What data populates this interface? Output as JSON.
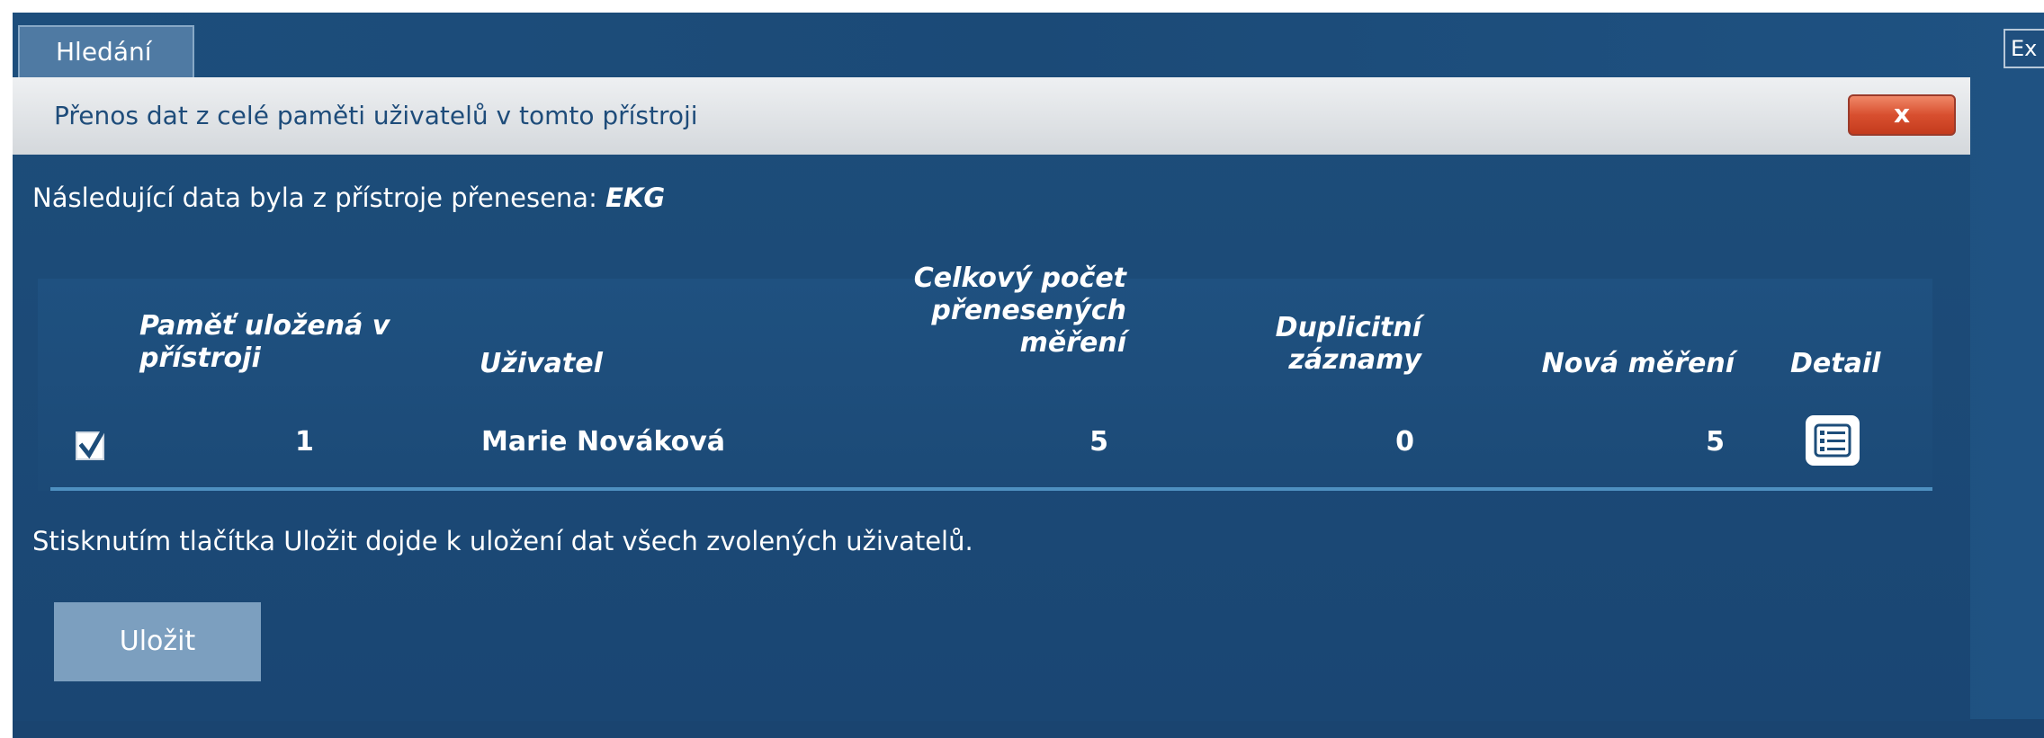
{
  "tab": {
    "label": "Hledání"
  },
  "exit_button": {
    "label": "Ex"
  },
  "dialog": {
    "title": "Přenos dat z celé paměti uživatelů v tomto přístroji",
    "close_label": "x",
    "info_prefix": "Následující data byla z přístroje přenesena:",
    "info_type": "EKG",
    "footer_text": "Stisknutím tlačítka Uložit dojde k uložení dat všech zvolených uživatelů.",
    "save_label": "Uložit"
  },
  "table": {
    "headers": {
      "memory_line1": "Paměť uložená v",
      "memory_line2": "přístroji",
      "user": "Uživatel",
      "total_line1": "Celkový počet",
      "total_line2": "přenesených",
      "total_line3": "měření",
      "dup_line1": "Duplicitní",
      "dup_line2": "záznamy",
      "new": "Nová měření",
      "detail": "Detail"
    },
    "rows": [
      {
        "checked": true,
        "memory": "1",
        "user": "Marie Nováková",
        "total": "5",
        "duplicates": "0",
        "new": "5"
      }
    ]
  },
  "icons": {
    "close": "close-icon",
    "checkbox": "check-icon",
    "detail": "list-icon"
  }
}
